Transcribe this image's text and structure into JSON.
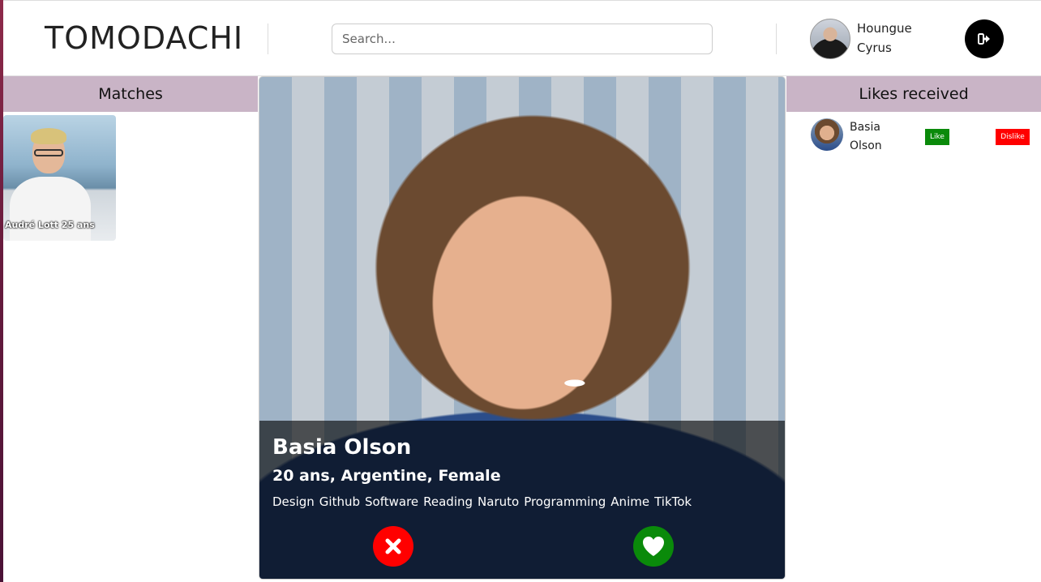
{
  "app": {
    "title": "TOMODACHI"
  },
  "search": {
    "placeholder": "Search..."
  },
  "user": {
    "first_name": "Houngue",
    "last_name": "Cyrus",
    "avatar_icon": "user-avatar"
  },
  "logout": {
    "icon": "logout-icon"
  },
  "matches": {
    "title": "Matches",
    "items": [
      {
        "label": "Audré Lott 25 ans"
      }
    ]
  },
  "profile": {
    "name": "Basia Olson",
    "info": "20 ans, Argentine, Female",
    "tags": [
      "Design",
      "Github",
      "Software",
      "Reading",
      "Naruto",
      "Programming",
      "Anime",
      "TikTok"
    ],
    "dislike_icon": "x-icon",
    "like_icon": "heart-icon"
  },
  "likes_received": {
    "title": "Likes received",
    "items": [
      {
        "first_name": "Basia",
        "last_name": "Olson",
        "like_label": "Like",
        "dislike_label": "Dislike"
      }
    ]
  },
  "colors": {
    "panel_header": "#c9b4c6",
    "like": "#0a8a0a",
    "dislike": "#ff0000",
    "logout_button": "#000000"
  }
}
